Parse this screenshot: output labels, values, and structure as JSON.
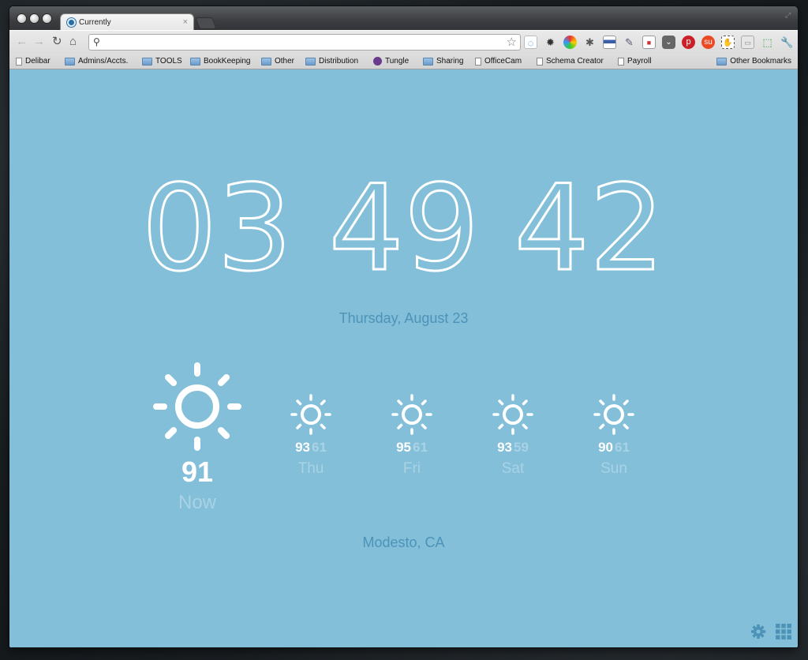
{
  "browser": {
    "tab_title": "Currently",
    "tab_close": "×",
    "address_value": "",
    "bookmarks": [
      {
        "label": "Delibar",
        "type": "page"
      },
      {
        "label": "Admins/Accts.",
        "type": "folder"
      },
      {
        "label": "TOOLS",
        "type": "folder"
      },
      {
        "label": "BookKeeping",
        "type": "folder"
      },
      {
        "label": "Other",
        "type": "folder"
      },
      {
        "label": "Distribution",
        "type": "folder"
      },
      {
        "label": "Tungle",
        "type": "tungle"
      },
      {
        "label": "Sharing",
        "type": "folder"
      },
      {
        "label": "OfficeCam",
        "type": "page"
      },
      {
        "label": "Schema Creator",
        "type": "page"
      },
      {
        "label": "Payroll",
        "type": "page"
      }
    ],
    "other_bookmarks": "Other Bookmarks"
  },
  "clock": {
    "hours": "03",
    "minutes": "49",
    "seconds": "42"
  },
  "date": "Thursday, August 23",
  "weather": {
    "now": {
      "temp": "91",
      "label": "Now",
      "icon": "sun-icon"
    },
    "forecast": [
      {
        "high": "93",
        "low": "61",
        "day": "Thu",
        "icon": "sun-icon"
      },
      {
        "high": "95",
        "low": "61",
        "day": "Fri",
        "icon": "sun-icon"
      },
      {
        "high": "93",
        "low": "59",
        "day": "Sat",
        "icon": "sun-icon"
      },
      {
        "high": "90",
        "low": "61",
        "day": "Sun",
        "icon": "sun-icon"
      }
    ]
  },
  "location": "Modesto, CA",
  "colors": {
    "background": "#83bfd9",
    "accent_text": "#4d93b8",
    "muted_text": "#a9d2e5",
    "foreground": "#ffffff"
  }
}
